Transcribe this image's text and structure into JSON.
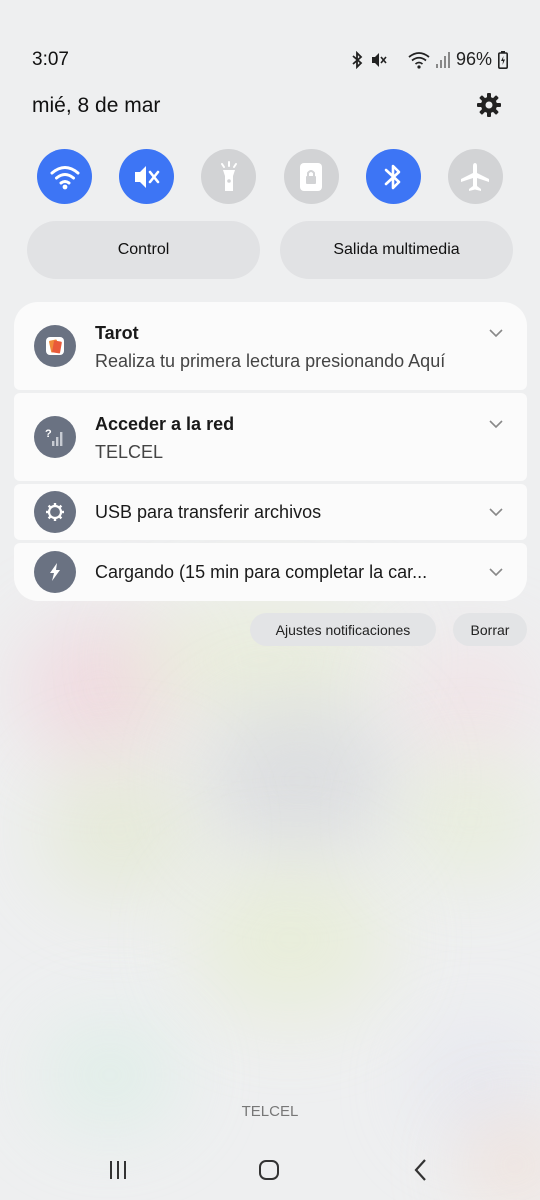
{
  "status_bar": {
    "time": "3:07",
    "battery": "96%",
    "icons": [
      "bluetooth-icon",
      "mute-icon",
      "wifi-icon",
      "signal-icon",
      "battery-icon"
    ]
  },
  "header": {
    "date": "mié, 8 de mar"
  },
  "quick_settings": [
    {
      "name": "wifi",
      "icon": "wifi-icon",
      "state": "on"
    },
    {
      "name": "sound",
      "icon": "mute-icon",
      "state": "on"
    },
    {
      "name": "flashlight",
      "icon": "flashlight-icon",
      "state": "off"
    },
    {
      "name": "rotation-lock",
      "icon": "lock-icon",
      "state": "off"
    },
    {
      "name": "bluetooth",
      "icon": "bluetooth-icon",
      "state": "on"
    },
    {
      "name": "airplane",
      "icon": "airplane-icon",
      "state": "off"
    }
  ],
  "pills": {
    "control": "Control",
    "media": "Salida multimedia"
  },
  "notifications": [
    {
      "title": "Tarot",
      "body": "Realiza tu primera lectura presionando Aquí",
      "icon": "tarot-app-icon"
    },
    {
      "title": "Acceder a la red",
      "body": "TELCEL",
      "icon": "no-signal-icon"
    },
    {
      "title": "USB para transferir archivos",
      "icon": "settings-icon"
    },
    {
      "title": "Cargando (15 min para completar la car...",
      "icon": "charging-icon"
    }
  ],
  "actions": {
    "settings": "Ajustes notificaciones",
    "clear": "Borrar"
  },
  "carrier": "TELCEL",
  "colors": {
    "accent": "#3d75f5",
    "toggle_off": "#d2d3d5",
    "notif_icon_bg": "#6a7282"
  }
}
